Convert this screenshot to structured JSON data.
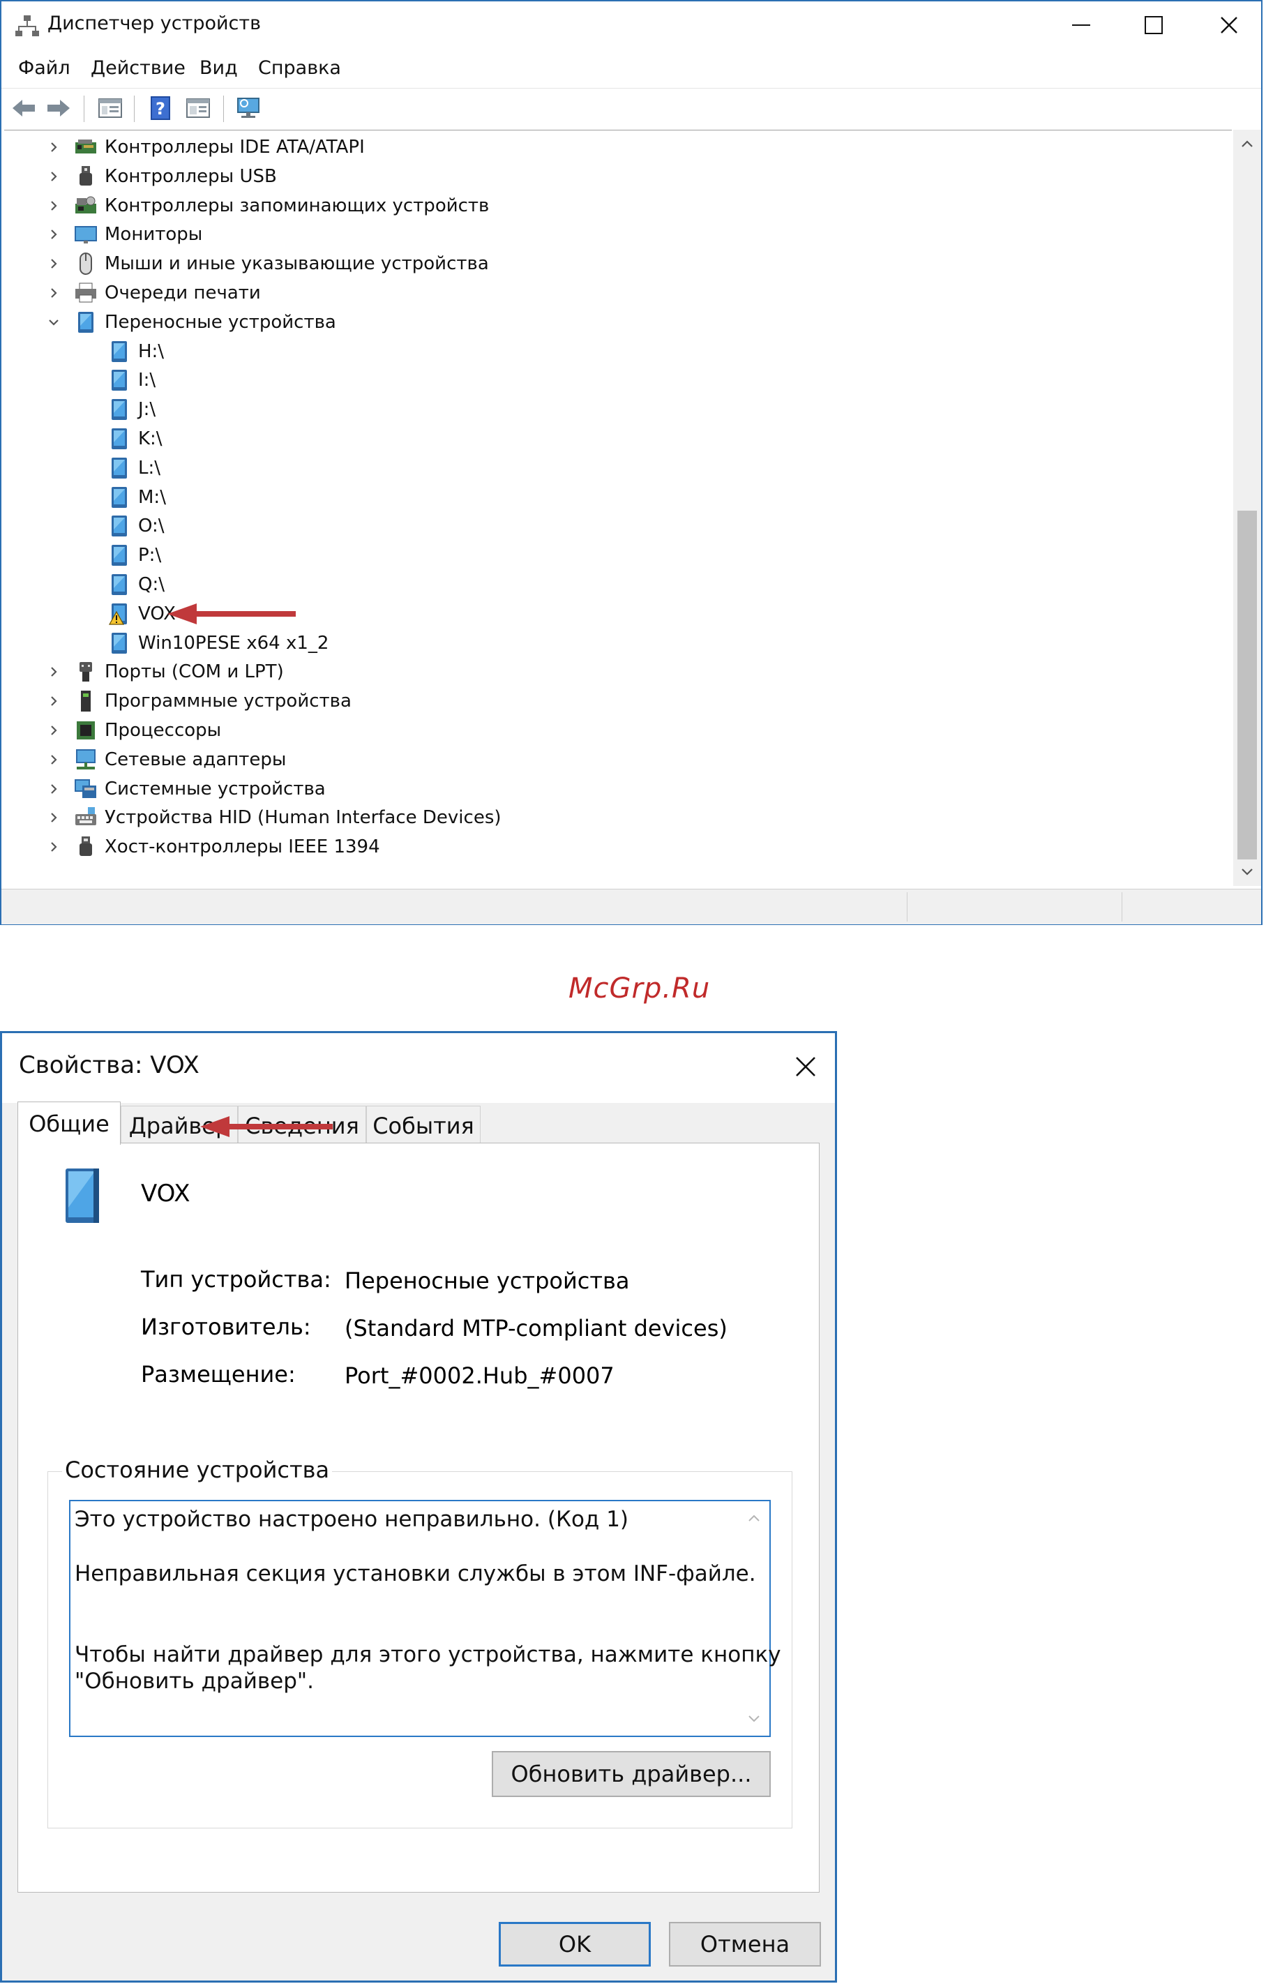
{
  "device_manager": {
    "title": "Диспетчер устройств",
    "menu": [
      {
        "label": "Файл"
      },
      {
        "label": "Действие"
      },
      {
        "label": "Вид"
      },
      {
        "label": "Справка"
      }
    ],
    "tree": [
      {
        "label": "Контроллеры IDE ATA/ATAPI",
        "icon": "ide-controller-icon",
        "state": "collapsed"
      },
      {
        "label": "Контроллеры USB",
        "icon": "usb-icon",
        "state": "collapsed"
      },
      {
        "label": "Контроллеры запоминающих устройств",
        "icon": "storage-controller-icon",
        "state": "collapsed"
      },
      {
        "label": "Мониторы",
        "icon": "monitor-icon",
        "state": "collapsed"
      },
      {
        "label": "Мыши и иные указывающие устройства",
        "icon": "mouse-icon",
        "state": "collapsed"
      },
      {
        "label": "Очереди печати",
        "icon": "printer-icon",
        "state": "collapsed"
      },
      {
        "label": "Переносные устройства",
        "icon": "portable-device-icon",
        "state": "expanded"
      },
      {
        "label": "H:\\",
        "icon": "portable-device-icon",
        "child": true
      },
      {
        "label": "I:\\",
        "icon": "portable-device-icon",
        "child": true
      },
      {
        "label": "J:\\",
        "icon": "portable-device-icon",
        "child": true
      },
      {
        "label": "K:\\",
        "icon": "portable-device-icon",
        "child": true
      },
      {
        "label": "L:\\",
        "icon": "portable-device-icon",
        "child": true
      },
      {
        "label": "M:\\",
        "icon": "portable-device-icon",
        "child": true
      },
      {
        "label": "O:\\",
        "icon": "portable-device-icon",
        "child": true
      },
      {
        "label": "P:\\",
        "icon": "portable-device-icon",
        "child": true
      },
      {
        "label": "Q:\\",
        "icon": "portable-device-icon",
        "child": true
      },
      {
        "label": "VOX",
        "icon": "warning-device-icon",
        "child": true
      },
      {
        "label": "Win10PESE x64 x1_2",
        "icon": "portable-device-icon",
        "child": true
      },
      {
        "label": "Порты (COM и LPT)",
        "icon": "port-icon",
        "state": "collapsed"
      },
      {
        "label": "Программные устройства",
        "icon": "software-device-icon",
        "state": "collapsed"
      },
      {
        "label": "Процессоры",
        "icon": "processor-icon",
        "state": "collapsed"
      },
      {
        "label": "Сетевые адаптеры",
        "icon": "network-adapter-icon",
        "state": "collapsed"
      },
      {
        "label": "Системные устройства",
        "icon": "system-device-icon",
        "state": "collapsed"
      },
      {
        "label": "Устройства HID (Human Interface Devices)",
        "icon": "hid-icon",
        "state": "collapsed"
      },
      {
        "label": "Хост-контроллеры IEEE 1394",
        "icon": "ieee1394-icon",
        "state": "collapsed"
      }
    ]
  },
  "watermark": "McGrp.Ru",
  "properties_dialog": {
    "title": "Свойства: VOX",
    "tabs": [
      {
        "label": "Общие",
        "active": true
      },
      {
        "label": "Драйвер"
      },
      {
        "label": "Сведения"
      },
      {
        "label": "События"
      }
    ],
    "device_name": "VOX",
    "fields": [
      {
        "label": "Тип устройства:",
        "value": "Переносные устройства"
      },
      {
        "label": "Изготовитель:",
        "value": "(Standard MTP-compliant devices)"
      },
      {
        "label": "Размещение:",
        "value": "Port_#0002.Hub_#0007"
      }
    ],
    "status_group_title": "Состояние устройства",
    "status_lines": [
      "Это устройство настроено неправильно. (Код 1)",
      "Неправильная секция установки службы в этом INF-файле.",
      "Чтобы найти драйвер для этого устройства, нажмите кнопку",
      "\"Обновить драйвер\"."
    ],
    "update_driver_button": "Обновить драйвер...",
    "ok_button": "OK",
    "cancel_button": "Отмена"
  },
  "colors": {
    "window_border": "#2b6fb3",
    "annotation_arrow": "#c0393b",
    "focus_blue": "#2a78c6"
  }
}
